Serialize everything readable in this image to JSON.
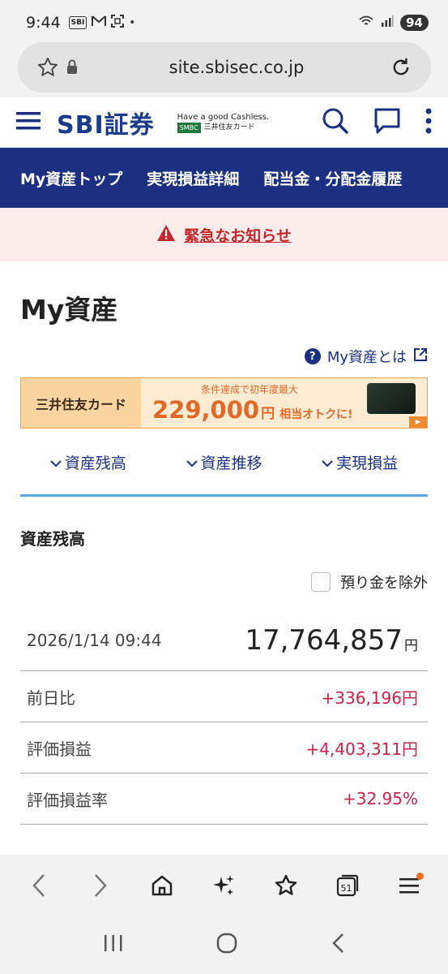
{
  "status_bar": {
    "time": "9:44",
    "sbi_badge": "SBI",
    "battery": "94"
  },
  "browser": {
    "url": "site.sbisec.co.jp"
  },
  "site": {
    "logo": "SBI証券",
    "promo_line1": "Have a good Cashless.",
    "promo_smbc": "SMBC",
    "promo_line2": "三井住友カード"
  },
  "nav": {
    "items": [
      {
        "label": "My資産トップ"
      },
      {
        "label": "実現損益詳細"
      },
      {
        "label": "配当金・分配金履歴"
      }
    ]
  },
  "alert": {
    "text": "緊急なお知らせ"
  },
  "page": {
    "title": "My資産",
    "help_link": "My資産とは"
  },
  "banner": {
    "left": "三井住友カード",
    "line1": "条件達成で初年度最大",
    "amount": "229,000",
    "unit": "円",
    "suffix": "相当オトクに!"
  },
  "tabs": [
    {
      "label": "資産残高"
    },
    {
      "label": "資産推移"
    },
    {
      "label": "実現損益"
    }
  ],
  "assets": {
    "section_title": "資産残高",
    "exclude_deposit_label": "預り金を除外",
    "datetime": "2026/1/14 09:44",
    "total": "17,764,857",
    "total_unit": "円",
    "rows": [
      {
        "label": "前日比",
        "value": "+336,196円"
      },
      {
        "label": "評価損益",
        "value": "+4,403,311円"
      },
      {
        "label": "評価損益率",
        "value": "+32.95%"
      }
    ]
  },
  "browser_bar": {
    "tab_count": "51"
  },
  "colors": {
    "brand_navy": "#1b3080",
    "alert_red": "#c0282d",
    "gain_red": "#c8234a",
    "tab_underline": "#5aa6dc"
  }
}
